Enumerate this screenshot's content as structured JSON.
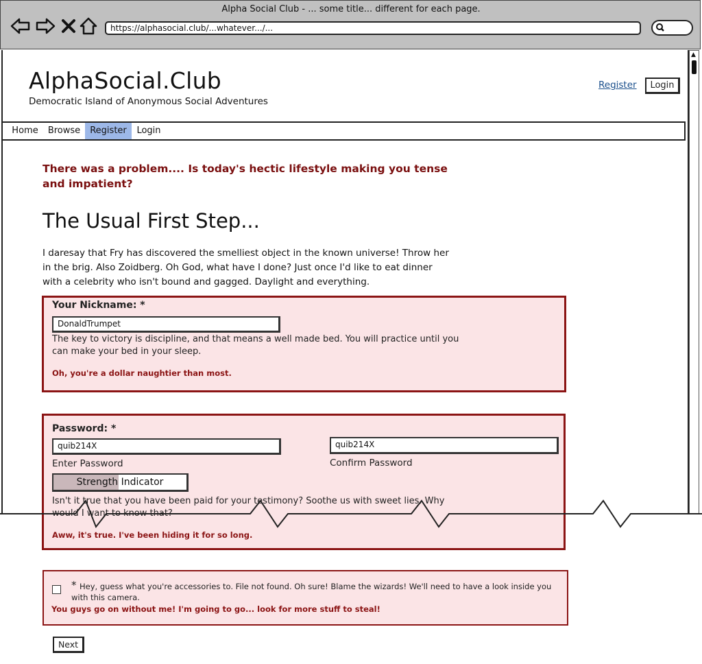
{
  "browser": {
    "window_title": "Alpha Social Club - ... some title... different for each page.",
    "url": "https://alphasocial.club/...whatever.../...",
    "back_icon": "arrow-left",
    "forward_icon": "arrow-right",
    "stop_icon": "x",
    "home_icon": "house",
    "search_icon": "magnifier"
  },
  "header": {
    "site_title": "AlphaSocial.Club",
    "tagline": "Democratic Island of Anonymous Social Adventures",
    "register_link": "Register",
    "login_button": "Login"
  },
  "nav": {
    "items": [
      {
        "label": "Home"
      },
      {
        "label": "Browse"
      },
      {
        "label": "Register",
        "active": true
      },
      {
        "label": "Login"
      }
    ],
    "active_color": "#9db8e8"
  },
  "main": {
    "error_message": "There was a problem.... Is today's hectic lifestyle making you tense and impatient?",
    "heading": "The Usual First Step...",
    "intro": "I daresay that Fry has discovered the smelliest object in the known universe! Throw her in the brig. Also Zoidberg. Oh God, what have I done? Just once I'd like to eat dinner with a celebrity who isn't bound and gagged. Daylight and everything."
  },
  "nickname": {
    "label": "Your Nickname: *",
    "value": "DonaldTrumpet",
    "help": "The key to victory is discipline, and that means a well made bed. You will practice until you can make your bed in your sleep.",
    "error": "Oh, you're a dollar naughtier than most."
  },
  "password": {
    "label": "Password: *",
    "value": "quib214X",
    "enter_label": "Enter Password",
    "confirm_value": "quib214X",
    "confirm_label": "Confirm Password",
    "strength_label": "Strength Indicator",
    "strength_level": 0.49,
    "help": "Isn't it true that you have been paid for your testimony? Soothe us with sweet lies. Why would I want to know that?",
    "error": "Aww, it's true. I've been hiding it for so long."
  },
  "terms": {
    "star": "*",
    "text": "Hey, guess what you're accessories to. File not found. Oh sure! Blame the wizards! We'll need to have a look inside you with this camera.",
    "error": "You guys go on without me! I'm going to go... look for more stuff to steal!",
    "checked": false
  },
  "actions": {
    "next": "Next"
  },
  "colors": {
    "panel_bg": "#fbe4e6",
    "panel_border": "#8b1414",
    "error_text": "#7a0f0f",
    "link": "#1a4f8c",
    "chrome_bg": "#c0c0c0"
  }
}
